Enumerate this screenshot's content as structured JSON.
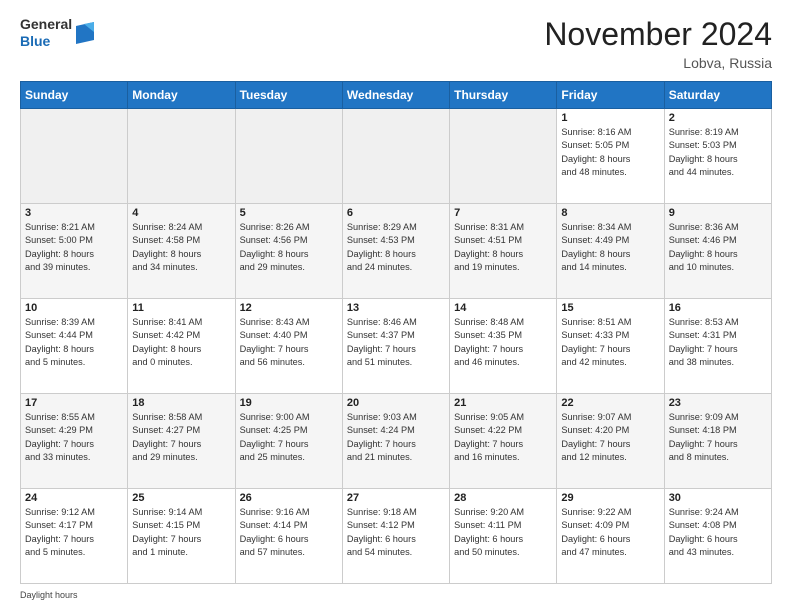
{
  "header": {
    "logo_line1": "General",
    "logo_line2": "Blue",
    "month": "November 2024",
    "location": "Lobva, Russia"
  },
  "weekdays": [
    "Sunday",
    "Monday",
    "Tuesday",
    "Wednesday",
    "Thursday",
    "Friday",
    "Saturday"
  ],
  "weeks": [
    [
      {
        "day": "",
        "info": ""
      },
      {
        "day": "",
        "info": ""
      },
      {
        "day": "",
        "info": ""
      },
      {
        "day": "",
        "info": ""
      },
      {
        "day": "",
        "info": ""
      },
      {
        "day": "1",
        "info": "Sunrise: 8:16 AM\nSunset: 5:05 PM\nDaylight: 8 hours\nand 48 minutes."
      },
      {
        "day": "2",
        "info": "Sunrise: 8:19 AM\nSunset: 5:03 PM\nDaylight: 8 hours\nand 44 minutes."
      }
    ],
    [
      {
        "day": "3",
        "info": "Sunrise: 8:21 AM\nSunset: 5:00 PM\nDaylight: 8 hours\nand 39 minutes."
      },
      {
        "day": "4",
        "info": "Sunrise: 8:24 AM\nSunset: 4:58 PM\nDaylight: 8 hours\nand 34 minutes."
      },
      {
        "day": "5",
        "info": "Sunrise: 8:26 AM\nSunset: 4:56 PM\nDaylight: 8 hours\nand 29 minutes."
      },
      {
        "day": "6",
        "info": "Sunrise: 8:29 AM\nSunset: 4:53 PM\nDaylight: 8 hours\nand 24 minutes."
      },
      {
        "day": "7",
        "info": "Sunrise: 8:31 AM\nSunset: 4:51 PM\nDaylight: 8 hours\nand 19 minutes."
      },
      {
        "day": "8",
        "info": "Sunrise: 8:34 AM\nSunset: 4:49 PM\nDaylight: 8 hours\nand 14 minutes."
      },
      {
        "day": "9",
        "info": "Sunrise: 8:36 AM\nSunset: 4:46 PM\nDaylight: 8 hours\nand 10 minutes."
      }
    ],
    [
      {
        "day": "10",
        "info": "Sunrise: 8:39 AM\nSunset: 4:44 PM\nDaylight: 8 hours\nand 5 minutes."
      },
      {
        "day": "11",
        "info": "Sunrise: 8:41 AM\nSunset: 4:42 PM\nDaylight: 8 hours\nand 0 minutes."
      },
      {
        "day": "12",
        "info": "Sunrise: 8:43 AM\nSunset: 4:40 PM\nDaylight: 7 hours\nand 56 minutes."
      },
      {
        "day": "13",
        "info": "Sunrise: 8:46 AM\nSunset: 4:37 PM\nDaylight: 7 hours\nand 51 minutes."
      },
      {
        "day": "14",
        "info": "Sunrise: 8:48 AM\nSunset: 4:35 PM\nDaylight: 7 hours\nand 46 minutes."
      },
      {
        "day": "15",
        "info": "Sunrise: 8:51 AM\nSunset: 4:33 PM\nDaylight: 7 hours\nand 42 minutes."
      },
      {
        "day": "16",
        "info": "Sunrise: 8:53 AM\nSunset: 4:31 PM\nDaylight: 7 hours\nand 38 minutes."
      }
    ],
    [
      {
        "day": "17",
        "info": "Sunrise: 8:55 AM\nSunset: 4:29 PM\nDaylight: 7 hours\nand 33 minutes."
      },
      {
        "day": "18",
        "info": "Sunrise: 8:58 AM\nSunset: 4:27 PM\nDaylight: 7 hours\nand 29 minutes."
      },
      {
        "day": "19",
        "info": "Sunrise: 9:00 AM\nSunset: 4:25 PM\nDaylight: 7 hours\nand 25 minutes."
      },
      {
        "day": "20",
        "info": "Sunrise: 9:03 AM\nSunset: 4:24 PM\nDaylight: 7 hours\nand 21 minutes."
      },
      {
        "day": "21",
        "info": "Sunrise: 9:05 AM\nSunset: 4:22 PM\nDaylight: 7 hours\nand 16 minutes."
      },
      {
        "day": "22",
        "info": "Sunrise: 9:07 AM\nSunset: 4:20 PM\nDaylight: 7 hours\nand 12 minutes."
      },
      {
        "day": "23",
        "info": "Sunrise: 9:09 AM\nSunset: 4:18 PM\nDaylight: 7 hours\nand 8 minutes."
      }
    ],
    [
      {
        "day": "24",
        "info": "Sunrise: 9:12 AM\nSunset: 4:17 PM\nDaylight: 7 hours\nand 5 minutes."
      },
      {
        "day": "25",
        "info": "Sunrise: 9:14 AM\nSunset: 4:15 PM\nDaylight: 7 hours\nand 1 minute."
      },
      {
        "day": "26",
        "info": "Sunrise: 9:16 AM\nSunset: 4:14 PM\nDaylight: 6 hours\nand 57 minutes."
      },
      {
        "day": "27",
        "info": "Sunrise: 9:18 AM\nSunset: 4:12 PM\nDaylight: 6 hours\nand 54 minutes."
      },
      {
        "day": "28",
        "info": "Sunrise: 9:20 AM\nSunset: 4:11 PM\nDaylight: 6 hours\nand 50 minutes."
      },
      {
        "day": "29",
        "info": "Sunrise: 9:22 AM\nSunset: 4:09 PM\nDaylight: 6 hours\nand 47 minutes."
      },
      {
        "day": "30",
        "info": "Sunrise: 9:24 AM\nSunset: 4:08 PM\nDaylight: 6 hours\nand 43 minutes."
      }
    ]
  ],
  "daylight_note": "Daylight hours"
}
